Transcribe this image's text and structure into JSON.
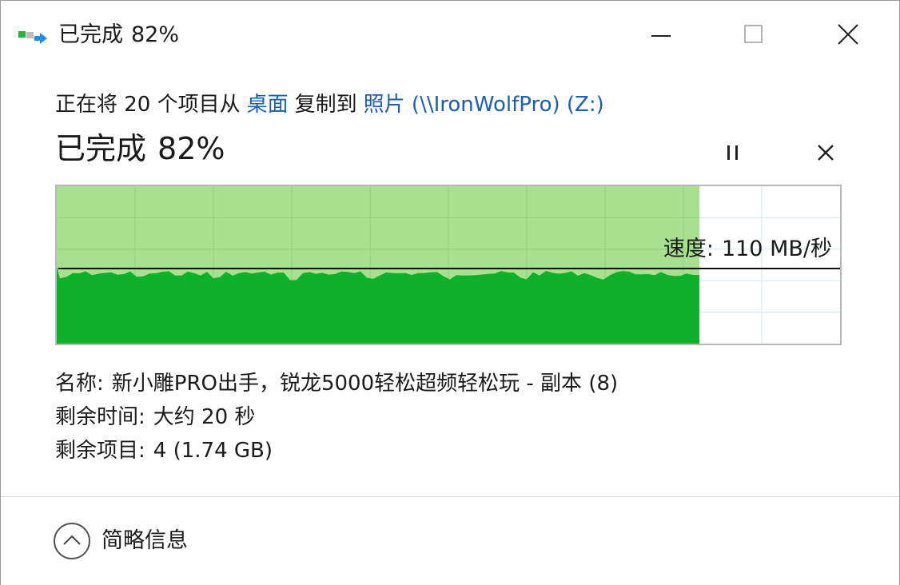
{
  "window": {
    "title_text": "已完成",
    "title_percent": "82%"
  },
  "header": {
    "prefix": "正在将 20 个项目从",
    "source": "桌面",
    "middle": "复制到",
    "destination": "照片 (\\\\IronWolfPro) (Z:)",
    "status_text": "已完成",
    "status_percent": "82%",
    "progress": 0.82
  },
  "graph": {
    "speed_label": "速度:",
    "speed_value": "110 MB/秒"
  },
  "details": {
    "name_label": "名称:",
    "name_value": "新小雕PRO出手，锐龙5000轻松超频轻松玩 - 副本 (8)",
    "time_label": "剩余时间:",
    "time_value": "大约 20 秒",
    "items_label": "剩余项目:",
    "items_value": "4 (1.74 GB)"
  },
  "footer": {
    "collapse_label": "简略信息"
  },
  "icons": {
    "app": "copy-files-icon",
    "minimize": "minimize-icon",
    "maximize": "maximize-icon",
    "close": "close-icon",
    "pause": "pause-icon",
    "cancel": "cancel-icon",
    "chevron": "chevron-up-icon"
  },
  "colors": {
    "progress_fill": "#a8e08f",
    "speed_fill": "#0db22a",
    "link": "#1a5fb4"
  }
}
